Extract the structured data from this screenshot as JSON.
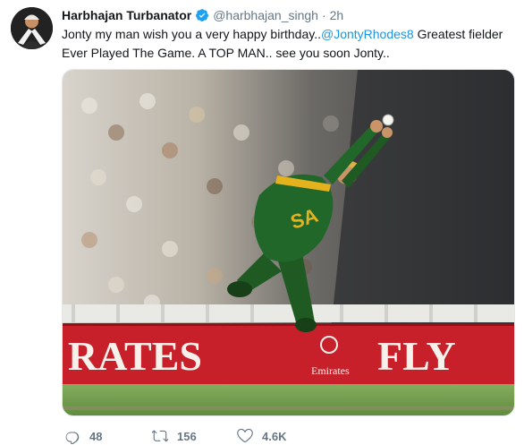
{
  "tweet": {
    "display_name": "Harbhajan Turbanator",
    "handle": "@harbhajan_singh",
    "separator": "·",
    "time": "2h",
    "text_before": "Jonty my man wish you a very happy birthday..",
    "mention": "@JontyRhodes8",
    "text_after": " Greatest fielder Ever Played The Game. A TOP MAN.. see you soon Jonty..",
    "media": {
      "banner_text_left": "RATES",
      "banner_text_right": "FLY",
      "banner_logo_text": "Emirates",
      "jersey_text": "SA"
    },
    "actions": {
      "reply_icon": "comment-icon",
      "reply_count": "48",
      "retweet_icon": "retweet-icon",
      "retweet_count": "156",
      "like_icon": "heart-icon",
      "like_count": "4.6K"
    }
  },
  "colors": {
    "link": "#1b95e0",
    "secondary_text": "#657786",
    "verified": "#1da1f2",
    "banner_red": "#c8202a",
    "jersey_green": "#1f5a22",
    "jersey_gold": "#e3b21c",
    "outfield_green": "#6f9a4a"
  }
}
